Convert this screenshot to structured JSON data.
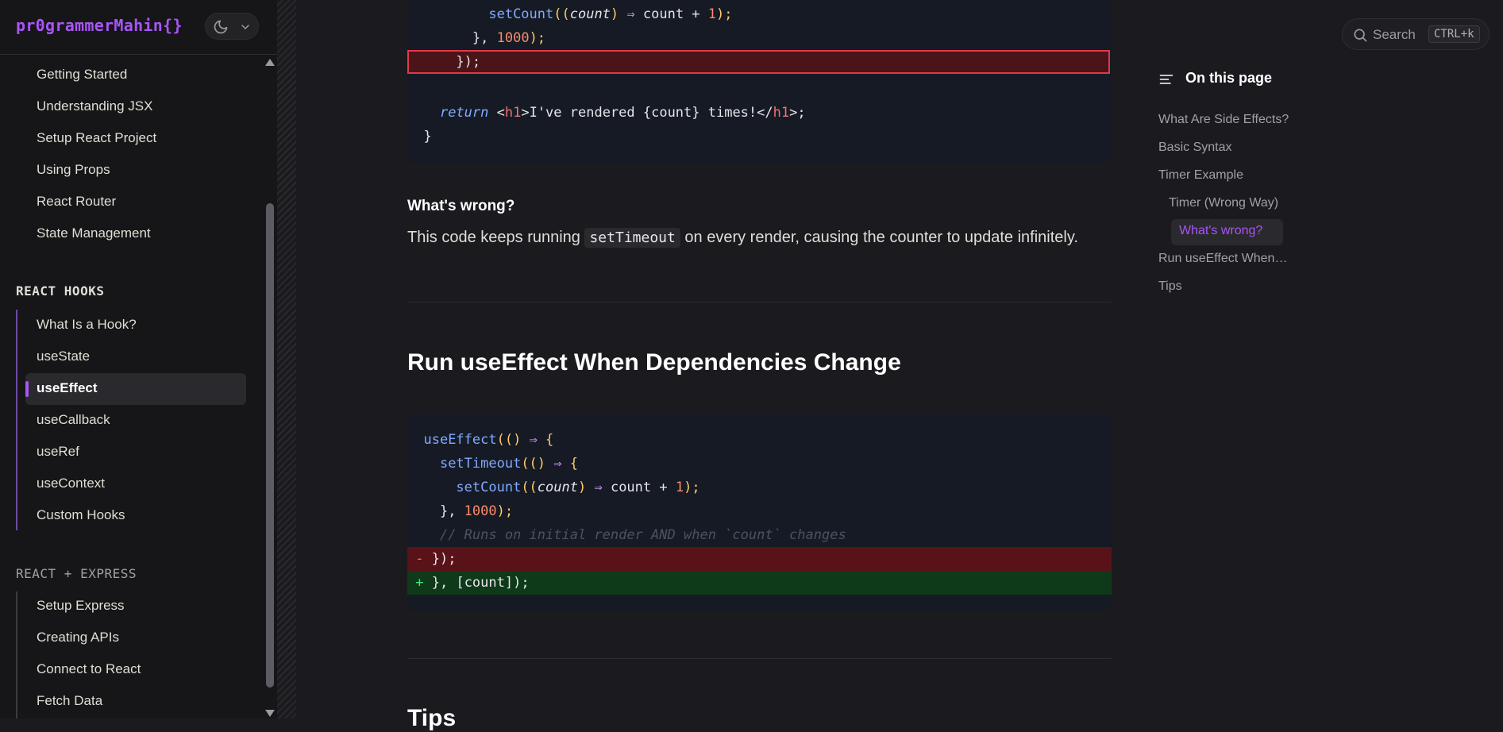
{
  "header": {
    "logo": "pr0grammerMahin{}"
  },
  "sidebar": {
    "top_items": [
      "Getting Started",
      "Understanding JSX",
      "Setup React Project",
      "Using Props",
      "React Router",
      "State Management"
    ],
    "hooks_title": "REACT HOOKS",
    "hooks_items": [
      "What Is a Hook?",
      "useState",
      "useEffect",
      "useCallback",
      "useRef",
      "useContext",
      "Custom Hooks"
    ],
    "active_item": "useEffect",
    "express_title": "REACT + EXPRESS",
    "express_items": [
      "Setup Express",
      "Creating APIs",
      "Connect to React",
      "Fetch Data"
    ]
  },
  "search": {
    "label": "Search",
    "shortcut": "CTRL+k"
  },
  "content": {
    "block1": {
      "l1": {
        "fn": "setCount",
        "p": "((",
        "param": "count",
        "p2": ")",
        "arrow": " ⇒ ",
        "rest": "count + ",
        "num": "1",
        "end": ");"
      },
      "l2": {
        "a": "}, ",
        "num": "1000",
        "b": ");"
      },
      "l3": "});",
      "l4": {
        "kw": "return",
        "sp": " <",
        "tag": "h1",
        "text": ">I've rendered {count} times!</",
        "tag2": "h1",
        "end": ">;"
      },
      "l5": "}"
    },
    "wrong_heading": "What's wrong?",
    "wrong_before": "This code keeps running ",
    "wrong_code": "setTimeout",
    "wrong_after": " on every render, causing the counter to update infinitely.",
    "run_heading": "Run useEffect When Dependencies Change",
    "block2": {
      "l1": {
        "fn": "useEffect",
        "p": "(() ",
        "arrow": "⇒",
        "rest": " {"
      },
      "l2": {
        "fn": "setTimeout",
        "p": "(() ",
        "arrow": "⇒",
        "rest": " {"
      },
      "l3": {
        "fn": "setCount",
        "p": "((",
        "param": "count",
        "p2": ") ",
        "arrow": "⇒",
        "rest": " count + ",
        "num": "1",
        "end": ");"
      },
      "l4": {
        "a": "}, ",
        "num": "1000",
        "b": ");"
      },
      "l5": "// Runs on initial render AND when `count` changes",
      "del_mark": "-",
      "del": "});",
      "add_mark": "+",
      "add": "}, [count]);"
    },
    "tips_heading": "Tips"
  },
  "toc": {
    "title": "On this page",
    "items": [
      "What Are Side Effects?",
      "Basic Syntax",
      "Timer Example",
      "Timer (Wrong Way)",
      "What's wrong?",
      "Run useEffect When…",
      "Tips"
    ]
  },
  "colors": {
    "accent": "#a855f7",
    "diff_add": "#0f3a1a",
    "diff_del": "#5a1219"
  }
}
